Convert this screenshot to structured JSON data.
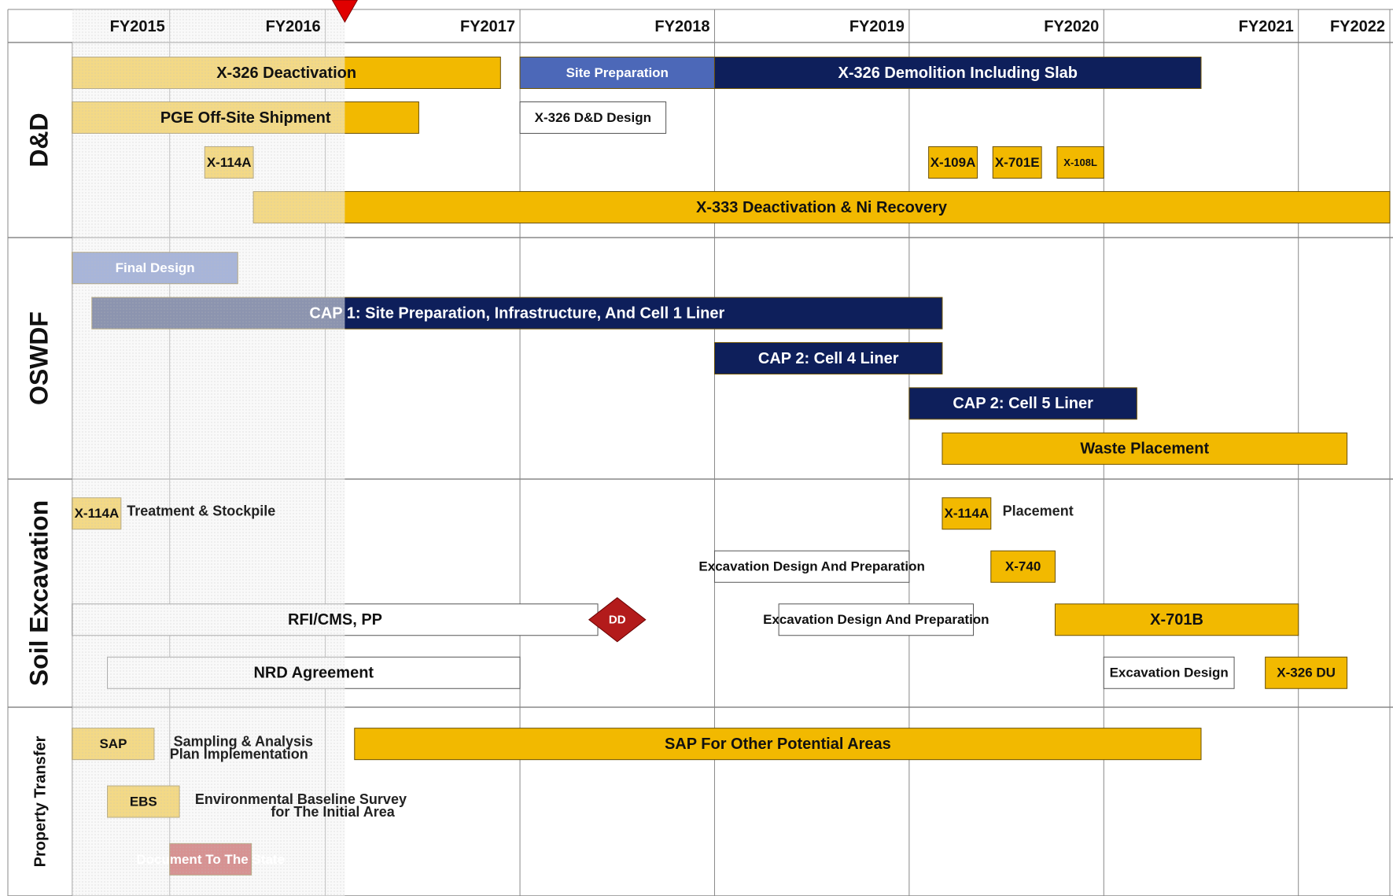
{
  "chart_data": {
    "type": "gantt",
    "title": "",
    "fiscal_years": [
      "FY2015",
      "FY2016",
      "FY2017",
      "FY2018",
      "FY2019",
      "FY2020",
      "FY2021",
      "FY2022"
    ],
    "time_range": [
      2014.7,
      2021.47
    ],
    "today_marker": 2016.1,
    "sections": [
      {
        "id": "dd",
        "label": "D&D",
        "rows": 4
      },
      {
        "id": "oswdf",
        "label": "OSWDF",
        "rows": 5
      },
      {
        "id": "soil",
        "label": "Soil Excavation",
        "rows": 4
      },
      {
        "id": "pt",
        "label": "Property Transfer",
        "rows": 3
      }
    ],
    "colors": {
      "gold": "#f2b900",
      "navy": "#0e1f5b",
      "blue": "#4c68b8",
      "white": "#ffffff",
      "red": "#b31b1b",
      "grid": "#888888",
      "past_overlay": "#eeeeee"
    },
    "tasks": [
      {
        "section": "dd",
        "row": 0,
        "label": "X-326 Deactivation",
        "start": 2014.7,
        "end": 2016.9,
        "style": "gold"
      },
      {
        "section": "dd",
        "row": 0,
        "label": "Site Preparation",
        "start": 2017.0,
        "end": 2018.0,
        "style": "blue"
      },
      {
        "section": "dd",
        "row": 0,
        "label": "X-326 Demolition Including Slab",
        "start": 2018.0,
        "end": 2020.5,
        "style": "navy"
      },
      {
        "section": "dd",
        "row": 1,
        "label": "PGE Off-Site Shipment",
        "start": 2014.7,
        "end": 2016.48,
        "style": "gold"
      },
      {
        "section": "dd",
        "row": 1,
        "label": "X-326 D&D Design",
        "start": 2017.0,
        "end": 2017.75,
        "style": "white"
      },
      {
        "section": "dd",
        "row": 2,
        "label": "X-114A",
        "start": 2015.38,
        "end": 2015.63,
        "style": "gold"
      },
      {
        "section": "dd",
        "row": 2,
        "label": "X-109A",
        "start": 2019.1,
        "end": 2019.35,
        "style": "gold"
      },
      {
        "section": "dd",
        "row": 2,
        "label": "X-701E",
        "start": 2019.43,
        "end": 2019.68,
        "style": "gold"
      },
      {
        "section": "dd",
        "row": 2,
        "label": "X-108L",
        "start": 2019.76,
        "end": 2020.0,
        "style": "gold"
      },
      {
        "section": "dd",
        "row": 3,
        "label": "X-333 Deactivation & Ni Recovery",
        "start": 2015.63,
        "end": 2021.47,
        "style": "gold"
      },
      {
        "section": "oswdf",
        "row": 0,
        "label": "Final Design",
        "start": 2014.7,
        "end": 2015.55,
        "style": "blue"
      },
      {
        "section": "oswdf",
        "row": 1,
        "label": "CAP 1: Site Preparation, Infrastructure, And Cell 1 Liner",
        "start": 2014.8,
        "end": 2019.17,
        "style": "navy"
      },
      {
        "section": "oswdf",
        "row": 2,
        "label": "CAP 2: Cell 4 Liner",
        "start": 2018.0,
        "end": 2019.17,
        "style": "navy"
      },
      {
        "section": "oswdf",
        "row": 3,
        "label": "CAP 2: Cell 5 Liner",
        "start": 2019.0,
        "end": 2020.17,
        "style": "navy"
      },
      {
        "section": "oswdf",
        "row": 4,
        "label": "Waste Placement",
        "start": 2019.17,
        "end": 2021.25,
        "style": "gold"
      },
      {
        "section": "soil",
        "row": 0,
        "label": "X-114A",
        "start": 2014.7,
        "end": 2014.95,
        "style": "gold"
      },
      {
        "section": "soil",
        "row": 0,
        "label": "X-114A",
        "start": 2019.17,
        "end": 2019.42,
        "style": "gold"
      },
      {
        "section": "soil",
        "row": 1,
        "label": "Excavation Design And Preparation",
        "start": 2018.0,
        "end": 2019.0,
        "style": "white"
      },
      {
        "section": "soil",
        "row": 1,
        "label": "X-740",
        "start": 2019.42,
        "end": 2019.75,
        "style": "gold"
      },
      {
        "section": "soil",
        "row": 2,
        "label": "RFI/CMS, PP",
        "start": 2014.7,
        "end": 2017.4,
        "style": "white"
      },
      {
        "section": "soil",
        "row": 2,
        "label": "Excavation Design And Preparation",
        "start": 2018.33,
        "end": 2019.33,
        "style": "white"
      },
      {
        "section": "soil",
        "row": 2,
        "label": "X-701B",
        "start": 2019.75,
        "end": 2021.0,
        "style": "gold"
      },
      {
        "section": "soil",
        "row": 3,
        "label": "NRD Agreement",
        "start": 2014.88,
        "end": 2017.0,
        "style": "white"
      },
      {
        "section": "soil",
        "row": 3,
        "label": "Excavation Design",
        "start": 2020.0,
        "end": 2020.67,
        "style": "white"
      },
      {
        "section": "soil",
        "row": 3,
        "label": "X-326 DU",
        "start": 2020.83,
        "end": 2021.25,
        "style": "gold"
      },
      {
        "section": "pt",
        "row": 0,
        "label": "SAP",
        "start": 2014.7,
        "end": 2015.12,
        "style": "gold"
      },
      {
        "section": "pt",
        "row": 0,
        "label": "SAP For Other Potential Areas",
        "start": 2016.15,
        "end": 2020.5,
        "style": "gold"
      },
      {
        "section": "pt",
        "row": 1,
        "label": "EBS",
        "start": 2014.88,
        "end": 2015.25,
        "style": "gold"
      },
      {
        "section": "pt",
        "row": 2,
        "label": "Document To The State",
        "start": 2015.2,
        "end": 2015.62,
        "style": "red"
      }
    ],
    "annotations": [
      {
        "section": "soil",
        "row": 0,
        "text": "Treatment & Stockpile",
        "at": 2014.98
      },
      {
        "section": "soil",
        "row": 0,
        "text": "Placement",
        "at": 2019.48
      },
      {
        "section": "pt",
        "row": 0,
        "text": "Sampling & Analysis",
        "at": 2015.22
      },
      {
        "section": "pt",
        "row": 0,
        "text": "Plan Implementation",
        "at": 2015.2
      },
      {
        "section": "pt",
        "row": 1,
        "text": "Environmental Baseline Survey",
        "at": 2015.33
      },
      {
        "section": "pt",
        "row": 1,
        "text": "for The Initial Area",
        "at": 2015.72
      }
    ],
    "milestones": [
      {
        "section": "soil",
        "row": 2,
        "label": "DD",
        "date": 2017.5
      }
    ]
  }
}
